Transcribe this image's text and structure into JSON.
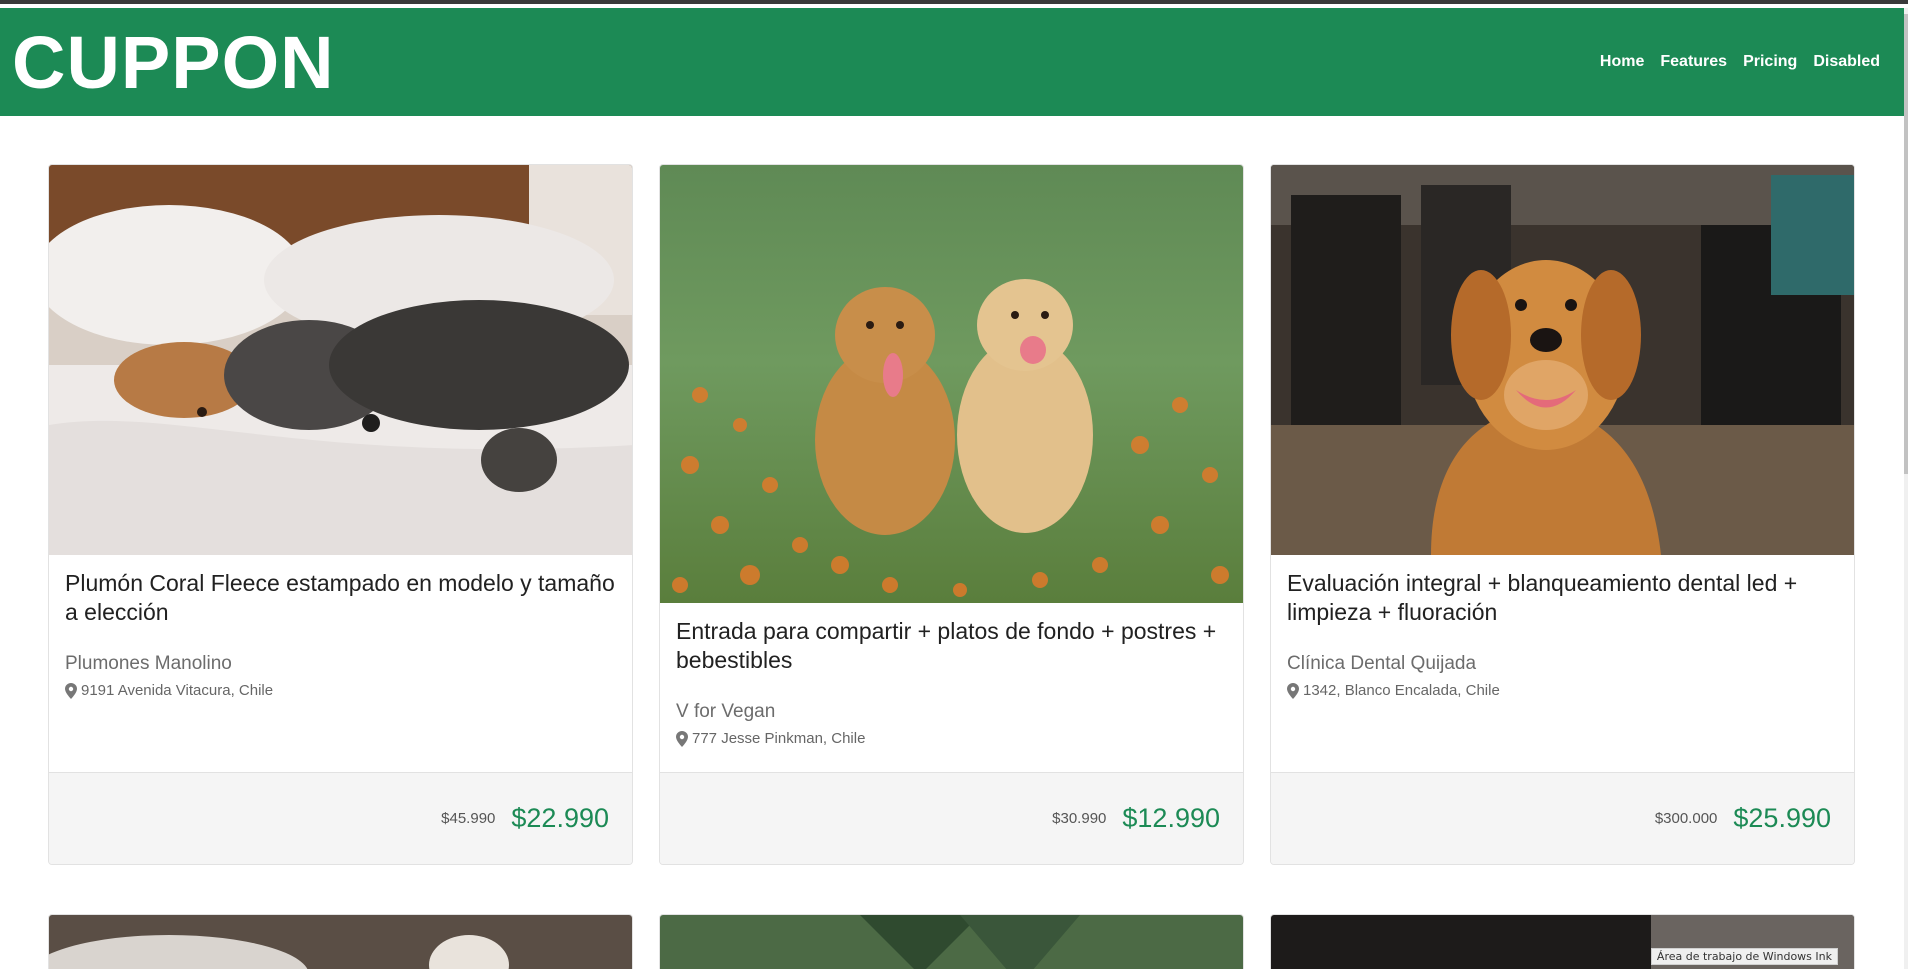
{
  "header": {
    "brand": "CUPPON",
    "nav": [
      "Home",
      "Features",
      "Pricing",
      "Disabled"
    ]
  },
  "cards": [
    {
      "title": "Plumón Coral Fleece estampado en modelo y tamaño a elección",
      "merchant": "Plumones Manolino",
      "address": "9191 Avenida Vitacura, Chile",
      "old_price": "$45.990",
      "new_price": "$22.990"
    },
    {
      "title": "Entrada para compartir + platos de fondo + postres + bebestibles",
      "merchant": "V for Vegan",
      "address": "777 Jesse Pinkman, Chile",
      "old_price": "$30.990",
      "new_price": "$12.990"
    },
    {
      "title": "Evaluación integral + blanqueamiento dental led + limpieza + fluoración",
      "merchant": "Clínica Dental Quijada",
      "address": "1342, Blanco Encalada, Chile",
      "old_price": "$300.000",
      "new_price": "$25.990"
    }
  ],
  "taskbar_label": "Área de trabajo de Windows Ink",
  "colors": {
    "brand": "#1c8a55",
    "price": "#1c8a55"
  },
  "icons": {
    "address": "map-pin-icon"
  }
}
